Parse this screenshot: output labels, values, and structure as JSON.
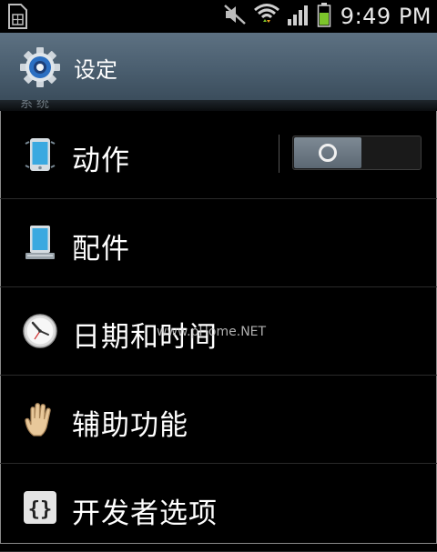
{
  "status_bar": {
    "time": "9:49 PM",
    "icons": [
      "sim-card-icon",
      "mute-icon",
      "wifi-icon",
      "signal-icon",
      "battery-icon"
    ]
  },
  "action_bar": {
    "title": "设定",
    "icon": "settings-gear-icon",
    "partial_header_text": "系统"
  },
  "settings": {
    "items": [
      {
        "label": "动作",
        "icon": "motion-phone-icon",
        "toggle": {
          "state": "off"
        }
      },
      {
        "label": "配件",
        "icon": "accessory-dock-icon"
      },
      {
        "label": "日期和时间",
        "icon": "clock-icon"
      },
      {
        "label": "辅助功能",
        "icon": "hand-icon"
      },
      {
        "label": "开发者选项",
        "icon": "braces-icon"
      }
    ]
  },
  "watermark": "www.pHome.NET",
  "colors": {
    "action_bar": "#4a5e6f",
    "background": "#000000",
    "toggle_knob": "#6b7782",
    "battery_green": "#7cc52b",
    "phone_blue": "#3aa9e0"
  }
}
